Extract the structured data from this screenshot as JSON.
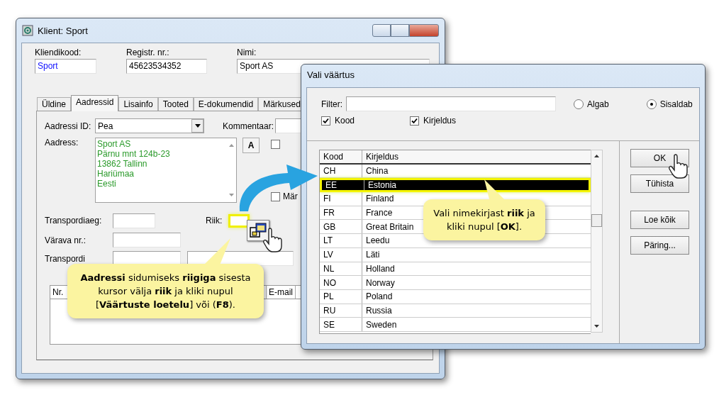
{
  "client_window": {
    "title": "Klient: Sport",
    "fields": [
      {
        "label": "Kliendikood:",
        "value": "Sport",
        "kind": "code"
      },
      {
        "label": "Registr. nr.:",
        "value": "45623534352",
        "kind": "plain"
      },
      {
        "label": "Nimi:",
        "value": "Sport AS",
        "kind": "wide"
      }
    ],
    "tabs": [
      {
        "label": "Üldine",
        "selected": false
      },
      {
        "label": "Aadressid",
        "selected": true
      },
      {
        "label": "Lisainfo",
        "selected": false
      },
      {
        "label": "Tooted",
        "selected": false
      },
      {
        "label": "E-dokumendid",
        "selected": false
      },
      {
        "label": "Märkused",
        "selected": false
      }
    ],
    "address_id": {
      "label": "Aadressi ID:",
      "value": "Pea"
    },
    "comment": {
      "label": "Kommentaar:"
    },
    "address": {
      "label": "Aadress:",
      "lines": [
        "Sport AS",
        "Pärnu mnt 124b-23",
        "13862 Tallinn",
        "Hariümaa",
        "Eesti"
      ]
    },
    "format_button": "A",
    "side_checkboxes": [
      {
        "checked": false
      },
      {
        "label": "Mär",
        "checked": false
      }
    ],
    "transport_time": {
      "label": "Transpordiaeg:"
    },
    "country": {
      "label": "Riik:",
      "highlighted": true
    },
    "gate": {
      "label": "Värava nr.:"
    },
    "service": {
      "label": "Transpordi"
    },
    "contacts_table": {
      "columns": [
        "Nr.",
        "E-mail"
      ]
    }
  },
  "value_dialog": {
    "title": "Vali väärtus",
    "filter": {
      "label": "Filter:"
    },
    "match_options": [
      {
        "label": "Algab",
        "selected": false
      },
      {
        "label": "Sisaldab",
        "selected": true
      }
    ],
    "search_columns": [
      {
        "label": "Kood",
        "checked": true
      },
      {
        "label": "Kirjeldus",
        "checked": true
      }
    ],
    "list": {
      "columns": [
        "Kood",
        "Kirjeldus"
      ],
      "rows": [
        {
          "code": "CH",
          "name": "China",
          "selected": false
        },
        {
          "code": "EE",
          "name": "Estonia",
          "selected": true
        },
        {
          "code": "FI",
          "name": "Finland",
          "selected": false
        },
        {
          "code": "FR",
          "name": "France",
          "selected": false
        },
        {
          "code": "GB",
          "name": "Great Britain",
          "selected": false
        },
        {
          "code": "LT",
          "name": "Leedu",
          "selected": false
        },
        {
          "code": "LV",
          "name": "Läti",
          "selected": false
        },
        {
          "code": "NL",
          "name": "Holland",
          "selected": false
        },
        {
          "code": "NO",
          "name": "Norway",
          "selected": false
        },
        {
          "code": "PL",
          "name": "Poland",
          "selected": false
        },
        {
          "code": "RU",
          "name": "Russia",
          "selected": false
        },
        {
          "code": "SE",
          "name": "Sweden",
          "selected": false
        }
      ]
    },
    "buttons": [
      "OK",
      "Tühista",
      "Loe kõik",
      "Päring..."
    ]
  },
  "callouts": [
    {
      "text": "**Aadressi** sidumiseks **riigiga** sisesta kursor välja **riik** ja kliki nupul [**Väärtuste loetelu**] või (**F8**)."
    },
    {
      "text": "Vali nimekirjast **riik** ja kliki nupul [**OK**]."
    }
  ]
}
